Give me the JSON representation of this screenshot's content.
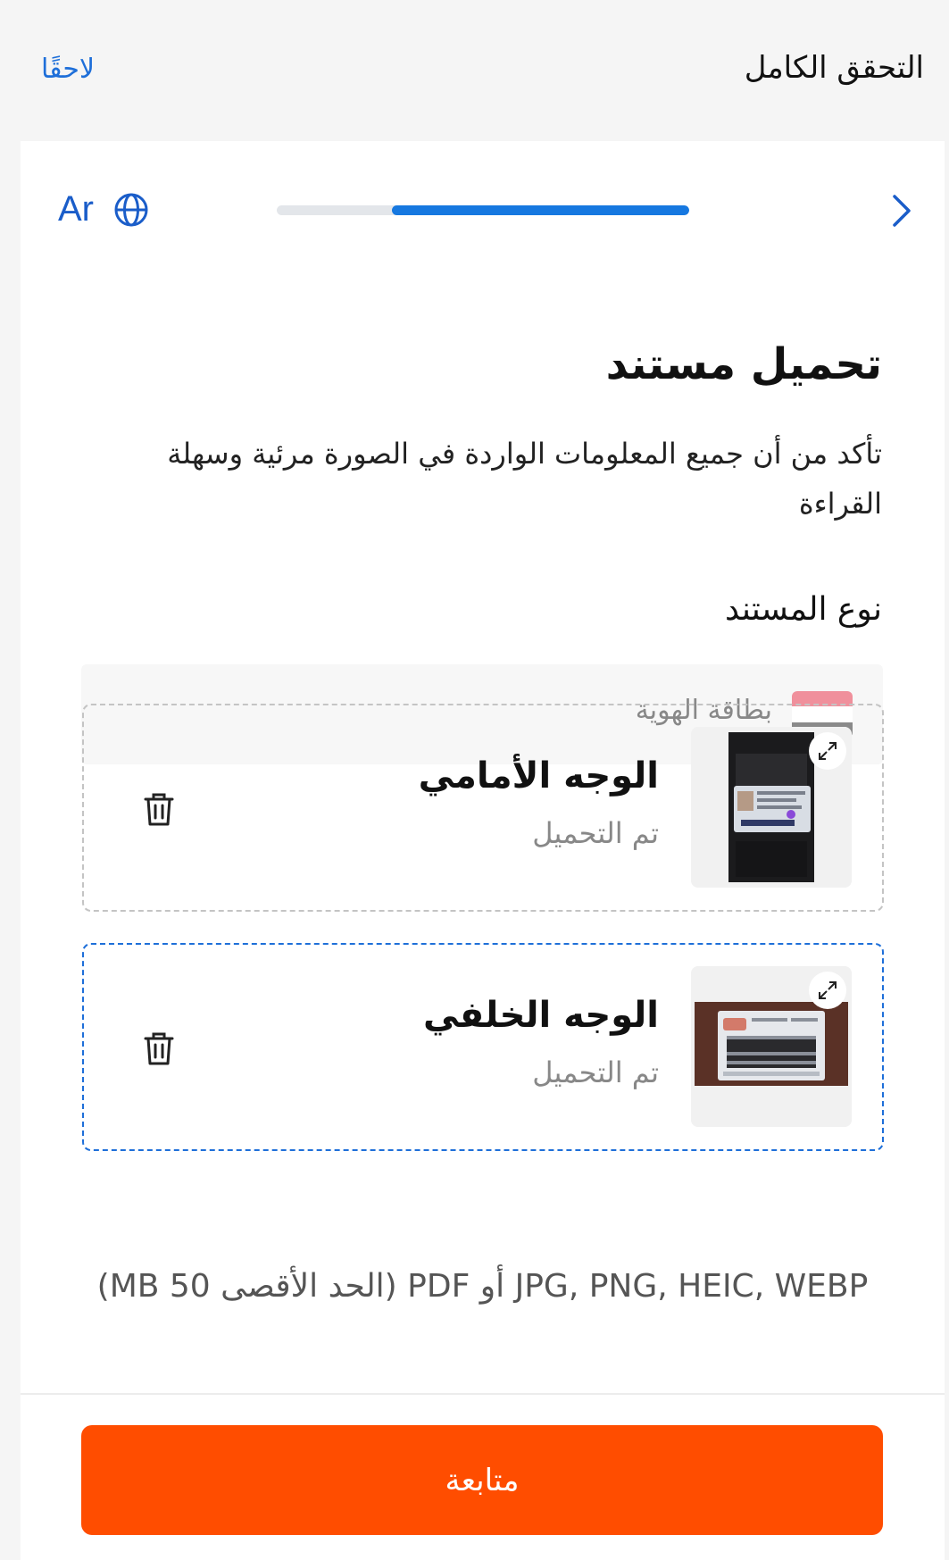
{
  "header": {
    "title": "التحقق الكامل",
    "later_label": "لاحقًا"
  },
  "toolbar": {
    "language_label": "Ar",
    "language_icon": "globe-icon",
    "next_icon": "chevron-right-icon",
    "progress_fraction": 0.72
  },
  "main": {
    "heading": "تحميل مستند",
    "subtitle": "تأكد من أن جميع المعلومات الواردة في الصورة مرئية وسهلة القراءة",
    "document_type_label": "نوع المستند",
    "document_type_value": "بطاقة الهوية",
    "flag_colors": [
      "#f0909c",
      "#ffffff",
      "#8a8a8a"
    ],
    "uploads": [
      {
        "title": "الوجه الأمامي",
        "status": "تم التحميل",
        "active": false
      },
      {
        "title": "الوجه الخلفي",
        "status": "تم التحميل",
        "active": true
      }
    ],
    "formats_note": "JPG, PNG, HEIC, WEBP أو PDF (الحد الأقصى 50 MB)"
  },
  "footer": {
    "continue_label": "متابعة"
  },
  "colors": {
    "accent_blue": "#1678e0",
    "primary_orange": "#ff4d00"
  }
}
